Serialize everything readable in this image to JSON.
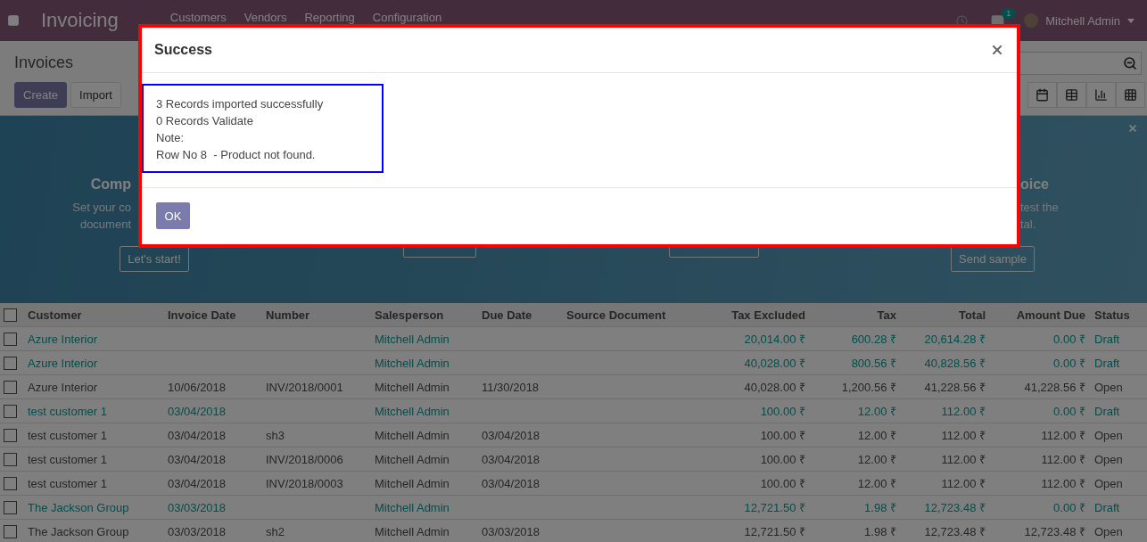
{
  "navbar": {
    "app_name": "Invoicing",
    "menu": [
      "Customers",
      "Vendors",
      "Reporting",
      "Configuration"
    ],
    "messages_badge": "1",
    "user": "Mitchell Admin"
  },
  "control_panel": {
    "title": "Invoices",
    "buttons": [
      {
        "label": "Create",
        "kind": "primary"
      },
      {
        "label": "Import",
        "kind": "secondary"
      }
    ]
  },
  "banner": {
    "columns": [
      {
        "kind": "step",
        "title": "Comp",
        "lines": [
          "Set your co",
          "document"
        ],
        "button": "Let's start!"
      },
      {
        "kind": "covered"
      },
      {
        "kind": "covered"
      },
      {
        "kind": "step",
        "title": "oice",
        "lines": [
          "test the",
          "tal."
        ],
        "button": "Send sample"
      }
    ]
  },
  "table": {
    "select_all_checked": false,
    "columns": [
      "Customer",
      "Invoice Date",
      "Number",
      "Salesperson",
      "Due Date",
      "Source Document",
      "Tax Excluded",
      "Tax",
      "Total",
      "Amount Due",
      "Status"
    ],
    "rows": [
      {
        "draft": true,
        "checked": false,
        "cells": [
          "Azure Interior",
          "",
          "",
          "Mitchell Admin",
          "",
          "",
          "20,014.00 ₹",
          "600.28 ₹",
          "20,614.28 ₹",
          "0.00 ₹",
          "Draft"
        ]
      },
      {
        "draft": true,
        "checked": false,
        "cells": [
          "Azure Interior",
          "",
          "",
          "Mitchell Admin",
          "",
          "",
          "40,028.00 ₹",
          "800.56 ₹",
          "40,828.56 ₹",
          "0.00 ₹",
          "Draft"
        ]
      },
      {
        "draft": false,
        "checked": false,
        "cells": [
          "Azure Interior",
          "10/06/2018",
          "INV/2018/0001",
          "Mitchell Admin",
          "11/30/2018",
          "",
          "40,028.00 ₹",
          "1,200.56 ₹",
          "41,228.56 ₹",
          "41,228.56 ₹",
          "Open"
        ]
      },
      {
        "draft": true,
        "checked": false,
        "cells": [
          "test customer 1",
          "03/04/2018",
          "",
          "Mitchell Admin",
          "",
          "",
          "100.00 ₹",
          "12.00 ₹",
          "112.00 ₹",
          "0.00 ₹",
          "Draft"
        ]
      },
      {
        "draft": false,
        "checked": false,
        "cells": [
          "test customer 1",
          "03/04/2018",
          "sh3",
          "Mitchell Admin",
          "03/04/2018",
          "",
          "100.00 ₹",
          "12.00 ₹",
          "112.00 ₹",
          "112.00 ₹",
          "Open"
        ]
      },
      {
        "draft": false,
        "checked": false,
        "cells": [
          "test customer 1",
          "03/04/2018",
          "INV/2018/0006",
          "Mitchell Admin",
          "03/04/2018",
          "",
          "100.00 ₹",
          "12.00 ₹",
          "112.00 ₹",
          "112.00 ₹",
          "Open"
        ]
      },
      {
        "draft": false,
        "checked": false,
        "cells": [
          "test customer 1",
          "03/04/2018",
          "INV/2018/0003",
          "Mitchell Admin",
          "03/04/2018",
          "",
          "100.00 ₹",
          "12.00 ₹",
          "112.00 ₹",
          "112.00 ₹",
          "Open"
        ]
      },
      {
        "draft": true,
        "checked": false,
        "cells": [
          "The Jackson Group",
          "03/03/2018",
          "",
          "Mitchell Admin",
          "",
          "",
          "12,721.50 ₹",
          "1.98 ₹",
          "12,723.48 ₹",
          "0.00 ₹",
          "Draft"
        ]
      },
      {
        "draft": false,
        "checked": false,
        "cells": [
          "The Jackson Group",
          "03/03/2018",
          "sh2",
          "Mitchell Admin",
          "03/03/2018",
          "",
          "12,721.50 ₹",
          "1.98 ₹",
          "12,723.48 ₹",
          "12,723.48 ₹",
          "Open"
        ]
      }
    ]
  },
  "dialog": {
    "title": "Success",
    "message": [
      "3 Records imported successfully",
      "0 Records Validate",
      "Note:",
      "Row No 8  - Product not found."
    ],
    "button": "OK"
  }
}
